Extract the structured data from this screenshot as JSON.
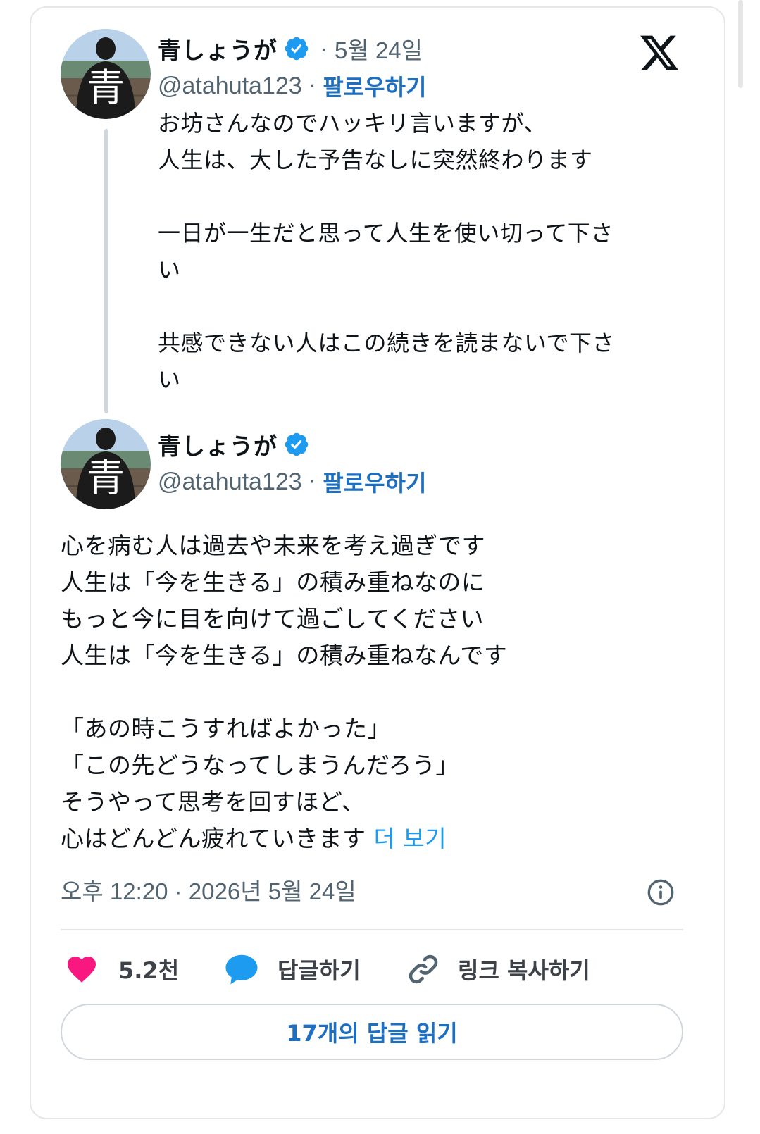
{
  "colors": {
    "accent": "#1d9bf0",
    "follow": "#1d6fc2",
    "verified": "#1d9bf0",
    "like": "#f91880",
    "text": "#0f1419",
    "muted": "#536471"
  },
  "logo": "x-logo",
  "posts": [
    {
      "author_name": "青しょうが",
      "verified_icon": "verified-badge-icon",
      "date_sep": "·",
      "date": "5월 24일",
      "handle": "@atahuta123",
      "handle_sep": "·",
      "follow_label": "팔로우하기",
      "avatar_text": "青",
      "text": "お坊さんなのでハッキリ言いますが、\n人生は、大した予告なしに突然終わります\n\n一日が一生だと思って人生を使い切って下さ\nい\n\n共感できない人はこの続きを読まないで下さ\nい"
    },
    {
      "author_name": "青しょうが",
      "verified_icon": "verified-badge-icon",
      "handle": "@atahuta123",
      "handle_sep": "·",
      "follow_label": "팔로우하기",
      "avatar_text": "青",
      "text": "心を病む人は過去や未来を考え過ぎです\n人生は「今を生きる」の積み重ねなのに\nもっと今に目を向けて過ごしてください\n人生は「今を生きる」の積み重ねなんです\n\n「あの時こうすればよかった」\n「この先どうなってしまうんだろう」\nそうやって思考を回すほど、\n心はどんどん疲れていきます",
      "more_label": "더 보기"
    }
  ],
  "timestamp": "오후 12:20 · 2026년 5월 24일",
  "info_icon": "info-icon",
  "actions": {
    "like_icon": "heart-icon",
    "like_count": "5.2천",
    "reply_icon": "reply-bubble-icon",
    "reply_label": "답글하기",
    "copy_icon": "link-icon",
    "copy_label": "링크 복사하기"
  },
  "read_replies_label": "17개의 답글 읽기"
}
